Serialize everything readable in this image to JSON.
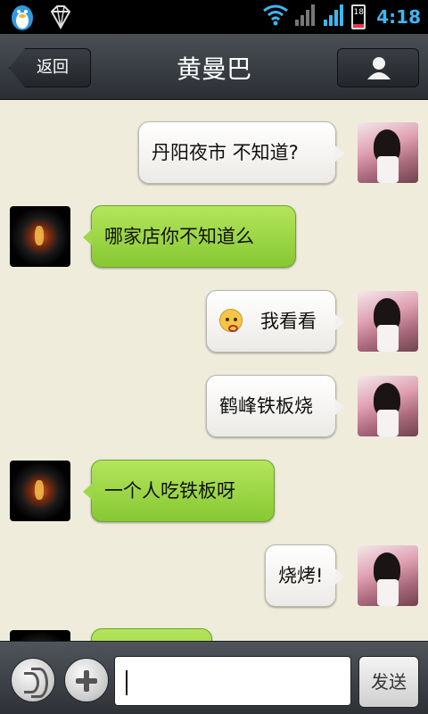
{
  "status_bar": {
    "time": "4:18",
    "battery_level": "18",
    "battery_fraction": 0.18,
    "icons": [
      "qq-penguin-icon",
      "diamond-icon",
      "wifi-icon",
      "signal-icon",
      "signal-icon",
      "battery-icon"
    ]
  },
  "header": {
    "title": "黄曼巴",
    "back_label": "返回",
    "profile_icon": "person-icon"
  },
  "messages": [
    {
      "sender": "self",
      "text": "丹阳夜市  不知道?"
    },
    {
      "sender": "other",
      "text": "哪家店你不知道么"
    },
    {
      "sender": "self",
      "text": "我看看",
      "emoji": "angry-face-emoji"
    },
    {
      "sender": "self",
      "text": "鹤峰铁板烧"
    },
    {
      "sender": "other",
      "text": "一个人吃铁板呀"
    },
    {
      "sender": "self",
      "text": "烧烤!"
    },
    {
      "sender": "other",
      "text": ""
    }
  ],
  "input_bar": {
    "voice_icon": "voice-icon",
    "plus_icon": "plus-icon",
    "input_value": "",
    "send_label": "发送"
  }
}
